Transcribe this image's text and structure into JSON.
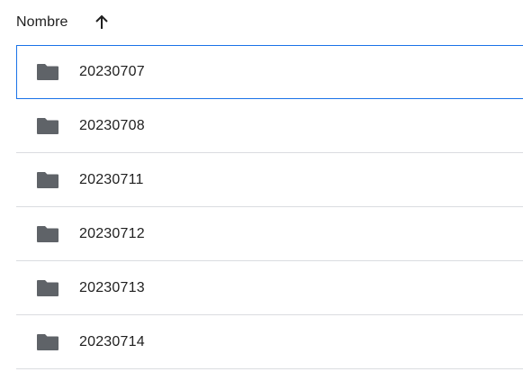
{
  "header": {
    "column_label": "Nombre",
    "sort_icon": "arrow-up-icon"
  },
  "rows": [
    {
      "name": "20230707",
      "icon": "folder-icon",
      "selected": true
    },
    {
      "name": "20230708",
      "icon": "folder-icon",
      "selected": false
    },
    {
      "name": "20230711",
      "icon": "folder-icon",
      "selected": false
    },
    {
      "name": "20230712",
      "icon": "folder-icon",
      "selected": false
    },
    {
      "name": "20230713",
      "icon": "folder-icon",
      "selected": false
    },
    {
      "name": "20230714",
      "icon": "folder-icon",
      "selected": false
    }
  ],
  "colors": {
    "folder": "#5f6368",
    "divider": "#dadce0",
    "selection": "#1a73e8"
  }
}
